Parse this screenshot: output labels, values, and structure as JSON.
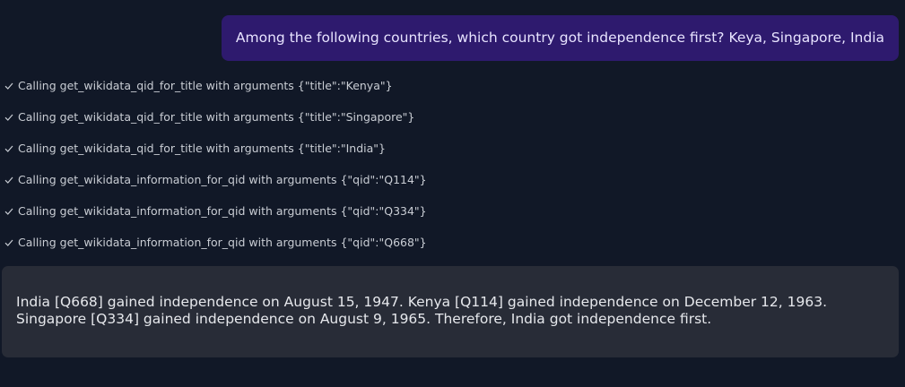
{
  "user_message": "Among the following countries, which country got independence first? Keya, Singapore, India",
  "tool_calls": [
    {
      "icon": "check-icon",
      "text": "Calling get_wikidata_qid_for_title with arguments {\"title\":\"Kenya\"}"
    },
    {
      "icon": "check-icon",
      "text": "Calling get_wikidata_qid_for_title with arguments {\"title\":\"Singapore\"}"
    },
    {
      "icon": "check-icon",
      "text": "Calling get_wikidata_qid_for_title with arguments {\"title\":\"India\"}"
    },
    {
      "icon": "check-icon",
      "text": "Calling get_wikidata_information_for_qid with arguments {\"qid\":\"Q114\"}"
    },
    {
      "icon": "check-icon",
      "text": "Calling get_wikidata_information_for_qid with arguments {\"qid\":\"Q334\"}"
    },
    {
      "icon": "check-icon",
      "text": "Calling get_wikidata_information_for_qid with arguments {\"qid\":\"Q668\"}"
    }
  ],
  "assistant_answer": "India [Q668] gained independence on August 15, 1947. Kenya [Q114] gained independence on December 12, 1963. Singapore [Q334] gained independence on August 9, 1965. Therefore, India got independence first.",
  "colors": {
    "background": "#111827",
    "user_bubble": "#2e1a6e",
    "answer_bubble": "#282c37",
    "check": "#c9cdd4"
  }
}
